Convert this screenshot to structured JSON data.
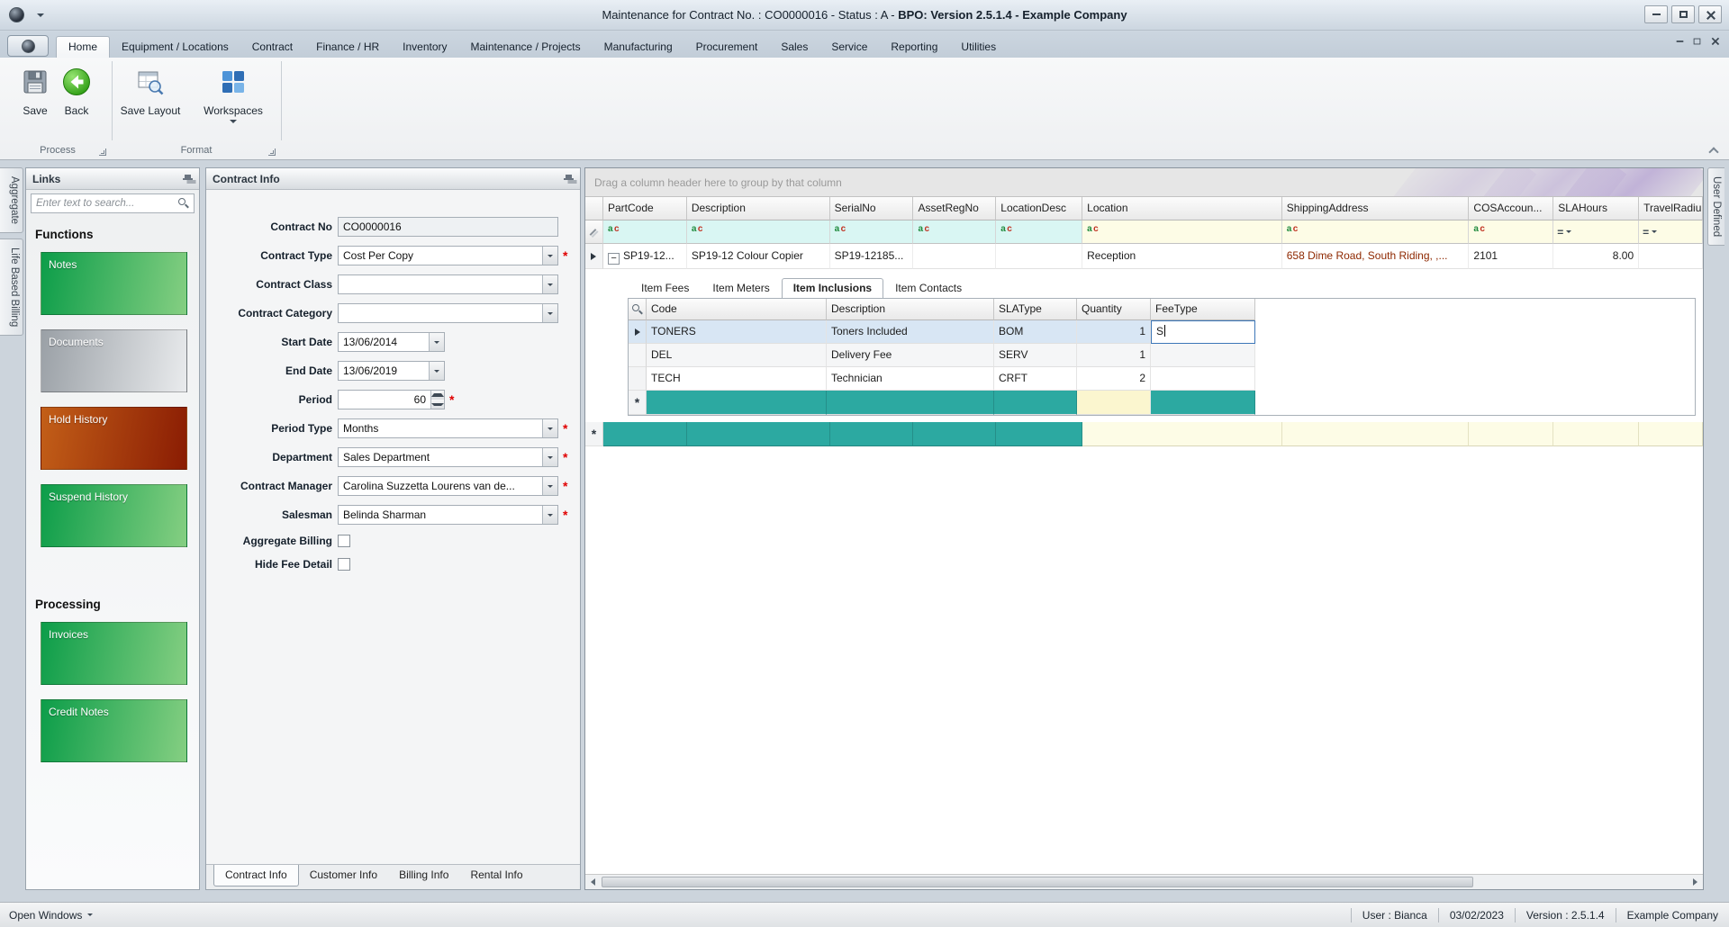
{
  "titlebar": {
    "title_normal": "Maintenance for Contract No. : CO0000016 - Status : A - ",
    "title_bold": "BPO: Version 2.5.1.4 - Example Company"
  },
  "ribbon": {
    "tabs": [
      {
        "label": "Home"
      },
      {
        "label": "Equipment / Locations"
      },
      {
        "label": "Contract"
      },
      {
        "label": "Finance / HR"
      },
      {
        "label": "Inventory"
      },
      {
        "label": "Maintenance / Projects"
      },
      {
        "label": "Manufacturing"
      },
      {
        "label": "Procurement"
      },
      {
        "label": "Sales"
      },
      {
        "label": "Service"
      },
      {
        "label": "Reporting"
      },
      {
        "label": "Utilities"
      }
    ],
    "buttons": {
      "save": "Save",
      "back": "Back",
      "save_layout": "Save Layout",
      "workspaces": "Workspaces"
    },
    "groups": {
      "process": "Process",
      "format": "Format"
    }
  },
  "dock": {
    "left_tabs": [
      "Aggregate",
      "Life Based Billing"
    ],
    "right_tabs": [
      "User Defined"
    ]
  },
  "links": {
    "title": "Links",
    "search_placeholder": "Enter text to search...",
    "functions_heading": "Functions",
    "processing_heading": "Processing",
    "buttons": {
      "notes": "Notes",
      "documents": "Documents",
      "hold_history": "Hold History",
      "suspend_history": "Suspend History",
      "invoices": "Invoices",
      "credit_notes": "Credit Notes"
    }
  },
  "contract": {
    "title": "Contract Info",
    "required_marker": "*",
    "fields": {
      "contract_no": {
        "label": "Contract No",
        "value": "CO0000016"
      },
      "contract_type": {
        "label": "Contract Type",
        "value": "Cost Per Copy"
      },
      "contract_class": {
        "label": "Contract Class",
        "value": ""
      },
      "contract_category": {
        "label": "Contract Category",
        "value": ""
      },
      "start_date": {
        "label": "Start Date",
        "value": "13/06/2014"
      },
      "end_date": {
        "label": "End Date",
        "value": "13/06/2019"
      },
      "period": {
        "label": "Period",
        "value": "60"
      },
      "period_type": {
        "label": "Period Type",
        "value": "Months"
      },
      "department": {
        "label": "Department",
        "value": "Sales Department"
      },
      "contract_manager": {
        "label": "Contract Manager",
        "value": "Carolina Suzzetta Lourens van de..."
      },
      "salesman": {
        "label": "Salesman",
        "value": "Belinda Sharman"
      },
      "aggregate_billing": {
        "label": "Aggregate Billing"
      },
      "hide_fee_detail": {
        "label": "Hide Fee Detail"
      }
    },
    "bottom_tabs": [
      {
        "label": "Contract Info"
      },
      {
        "label": "Customer Info"
      },
      {
        "label": "Billing Info"
      },
      {
        "label": "Rental Info"
      }
    ]
  },
  "grid": {
    "group_by_text": "Drag a column header here to group by that column",
    "filter_equals": "=",
    "expand_glyph": "−",
    "new_row_glyph": "*",
    "columns": [
      {
        "label": "PartCode"
      },
      {
        "label": "Description"
      },
      {
        "label": "SerialNo"
      },
      {
        "label": "AssetRegNo"
      },
      {
        "label": "LocationDesc"
      },
      {
        "label": "Location"
      },
      {
        "label": "ShippingAddress"
      },
      {
        "label": "COSAccoun..."
      },
      {
        "label": "SLAHours"
      },
      {
        "label": "TravelRadiu..."
      }
    ],
    "row": {
      "part_code": "SP19-12...",
      "description": "SP19-12 Colour Copier",
      "serial_no": "SP19-12185...",
      "asset_reg_no": "",
      "location_desc": "",
      "location": "Reception",
      "shipping_address": "658 Dime Road, South Riding, ,...",
      "cos_account": "2101",
      "sla_hours": "8.00",
      "travel_radius": ""
    },
    "detail": {
      "tabs": [
        {
          "label": "Item Fees"
        },
        {
          "label": "Item Meters"
        },
        {
          "label": "Item Inclusions"
        },
        {
          "label": "Item Contacts"
        }
      ],
      "columns": [
        {
          "label": "Code"
        },
        {
          "label": "Description"
        },
        {
          "label": "SLAType"
        },
        {
          "label": "Quantity"
        },
        {
          "label": "FeeType"
        }
      ],
      "rows": [
        {
          "code": "TONERS",
          "description": "Toners Included",
          "sla_type": "BOM",
          "quantity": "1",
          "fee_type": "S"
        },
        {
          "code": "DEL",
          "description": "Delivery Fee",
          "sla_type": "SERV",
          "quantity": "1",
          "fee_type": ""
        },
        {
          "code": "TECH",
          "description": "Technician",
          "sla_type": "CRFT",
          "quantity": "2",
          "fee_type": ""
        }
      ]
    }
  },
  "statusbar": {
    "open_windows": "Open Windows",
    "user": "User : Bianca",
    "date": "03/02/2023",
    "version": "Version : 2.5.1.4",
    "company": "Example Company"
  },
  "colors": {
    "link_button_green": "#0c9d49",
    "link_button_orange": "#c35f18",
    "new_row_teal": "#2ca9a1",
    "filter_cyan": "#d9f6f3",
    "filter_yellow": "#fdfce6",
    "required_red": "#e00000",
    "address_text": "#8e2800"
  }
}
